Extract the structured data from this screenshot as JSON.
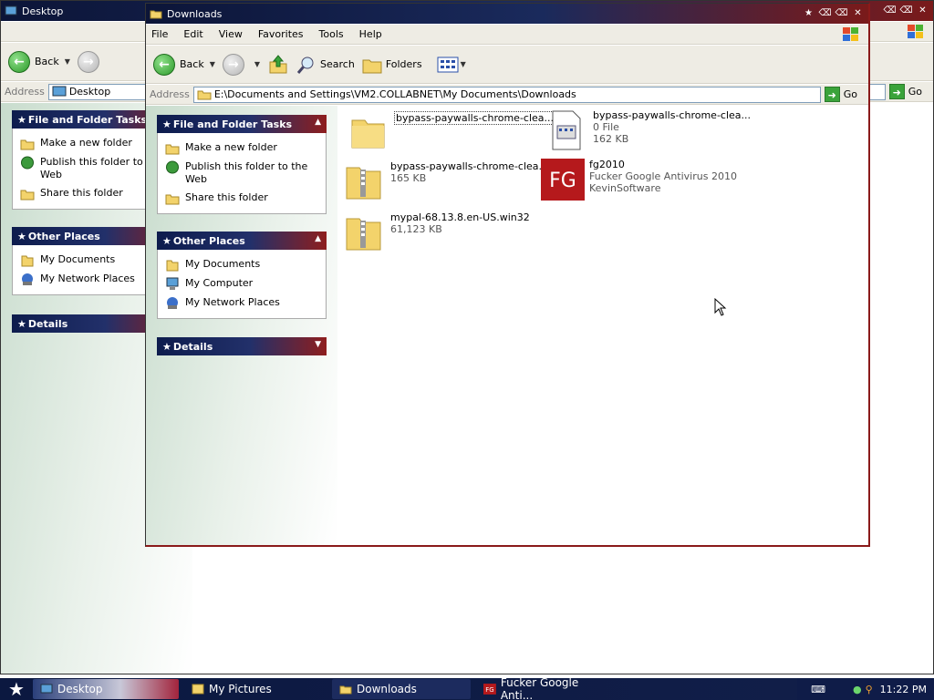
{
  "bg_window": {
    "title": "Desktop",
    "back_label": "Back",
    "address_label": "Address",
    "address_value": "Desktop",
    "go_label": "Go",
    "panels": [
      {
        "title": "File and Folder Tasks",
        "items": [
          "Make a new folder",
          "Publish this folder to the Web",
          "Share this folder"
        ]
      },
      {
        "title": "Other Places",
        "items": [
          "My Documents",
          "My Network Places"
        ]
      },
      {
        "title": "Details"
      }
    ]
  },
  "main_window": {
    "title": "Downloads",
    "menu": [
      "File",
      "Edit",
      "View",
      "Favorites",
      "Tools",
      "Help"
    ],
    "toolbar": {
      "back": "Back",
      "search": "Search",
      "folders": "Folders"
    },
    "address_label": "Address",
    "address_value": "E:\\Documents and Settings\\VM2.COLLABNET\\My Documents\\Downloads",
    "go_label": "Go",
    "panels": {
      "tasks": {
        "title": "File and Folder Tasks",
        "items": [
          "Make a new folder",
          "Publish this folder to the Web",
          "Share this folder"
        ]
      },
      "places": {
        "title": "Other Places",
        "items": [
          "My Documents",
          "My Computer",
          "My Network Places"
        ]
      },
      "details": {
        "title": "Details"
      }
    },
    "files": [
      {
        "name": "bypass-paywalls-chrome-clea...",
        "icon": "folder-icon",
        "selected": true
      },
      {
        "name": "bypass-paywalls-chrome-clea...",
        "line2": "0 File",
        "line3": "162 KB",
        "icon": "file-icon"
      },
      {
        "name": "bypass-paywalls-chrome-clea...",
        "line2": "165 KB",
        "icon": "zip-folder-icon"
      },
      {
        "name": "fg2010",
        "line2": "Fucker Google Antivirus 2010",
        "line3": "KevinSoftware",
        "icon": "fg-app-icon"
      },
      {
        "name": "mypal-68.13.8.en-US.win32",
        "line2": "61,123 KB",
        "icon": "zip-folder-icon"
      }
    ]
  },
  "taskbar": {
    "tasks": [
      {
        "label": "Desktop"
      },
      {
        "label": "My Pictures"
      },
      {
        "label": "Downloads"
      },
      {
        "label": "Fucker Google Anti..."
      }
    ],
    "clock": "11:22 PM"
  },
  "colors": {
    "title_blue": "#0c1538",
    "title_red": "#8e1e1e",
    "go_green": "#3aa33a"
  }
}
